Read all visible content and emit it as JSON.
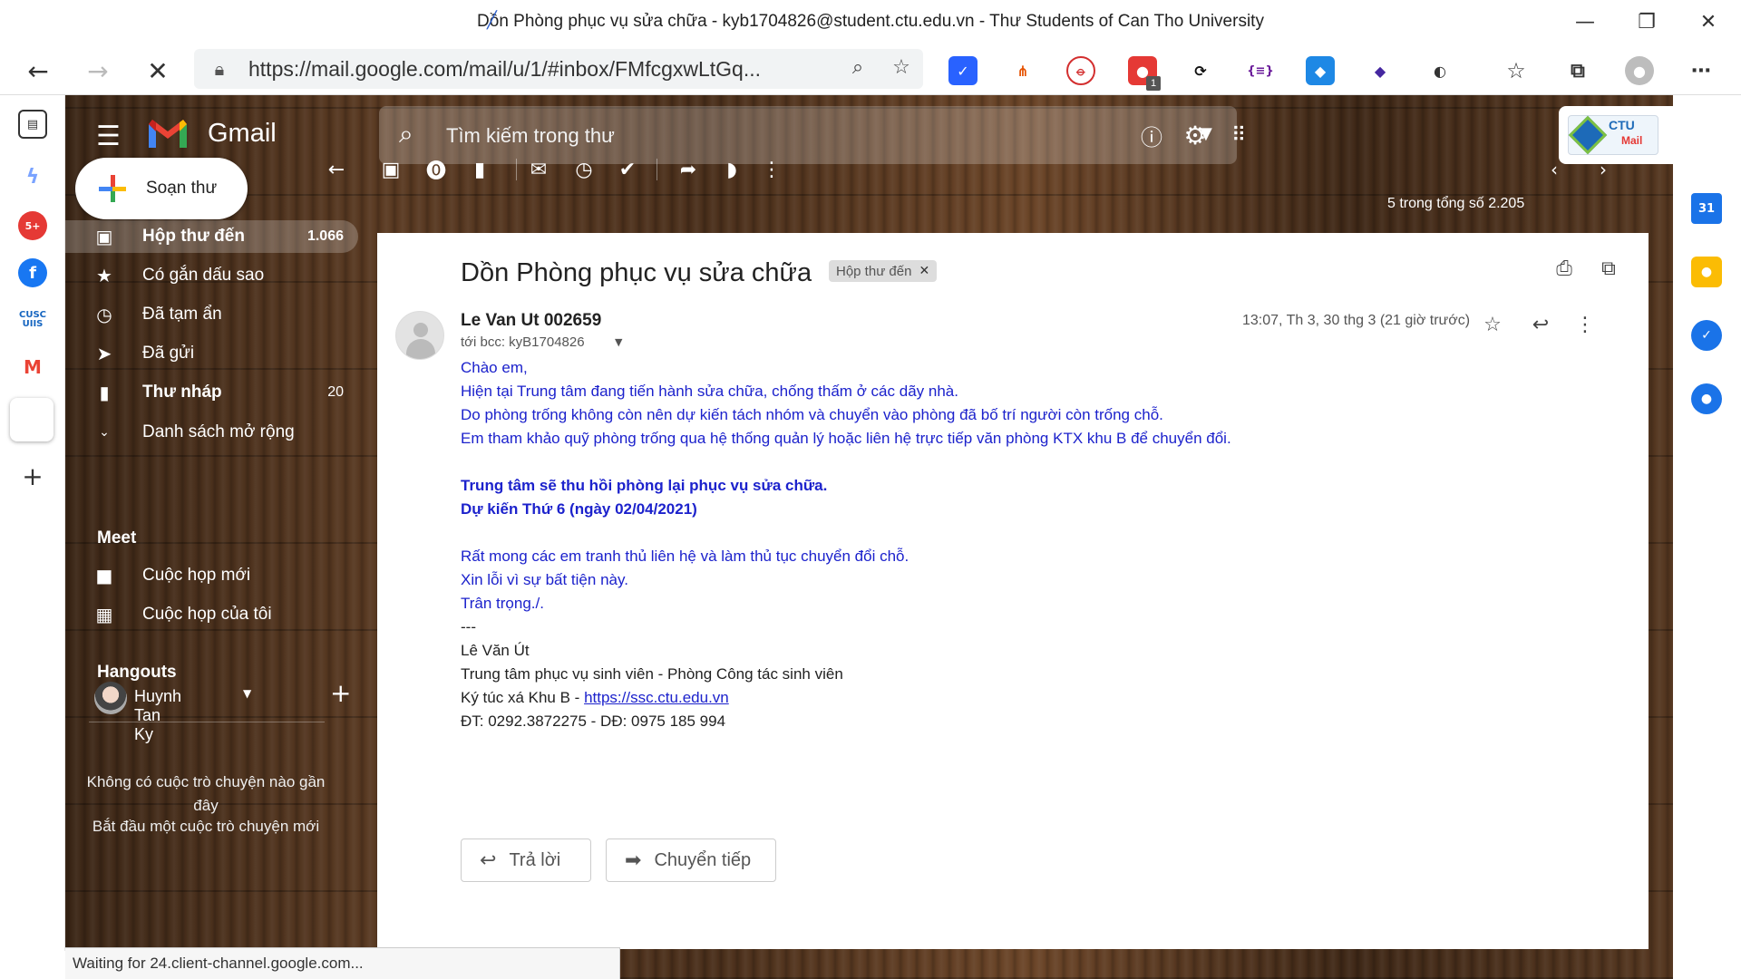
{
  "window": {
    "title": "Dồn Phòng phục vụ sửa chữa - kyb1704826@student.ctu.edu.vn - Thư Students of Can Tho University"
  },
  "browser": {
    "url": "https://mail.google.com/mail/u/1/#inbox/FMfcgxwLtGq...",
    "extension_badge": "1",
    "status_text": "Waiting for 24.client-channel.google.com..."
  },
  "gmail": {
    "brand": "Gmail",
    "search_placeholder": "Tìm kiếm trong thư",
    "account_logo": {
      "line1": "CTU",
      "line2": "Mail"
    },
    "compose_label": "Soạn thư",
    "nav": [
      {
        "label": "Hộp thư đến",
        "count": "1.066",
        "icon": "inbox-icon"
      },
      {
        "label": "Có gắn dấu sao",
        "count": "",
        "icon": "star-icon"
      },
      {
        "label": "Đã tạm ẩn",
        "count": "",
        "icon": "clock-icon"
      },
      {
        "label": "Đã gửi",
        "count": "",
        "icon": "send-icon"
      },
      {
        "label": "Thư nháp",
        "count": "20",
        "icon": "draft-icon"
      },
      {
        "label": "Danh sách mở rộng",
        "count": "",
        "icon": "chevron-down-icon"
      }
    ],
    "meet": {
      "title": "Meet",
      "items": [
        {
          "label": "Cuộc họp mới",
          "icon": "video-icon"
        },
        {
          "label": "Cuộc họp của tôi",
          "icon": "calendar-icon"
        }
      ]
    },
    "hangouts": {
      "title": "Hangouts",
      "user_name": "Huynh Tan Ky",
      "empty_text": "Không có cuộc trò chuyện nào gần đây",
      "start_text": "Bắt đầu một cuộc trò chuyện mới"
    },
    "paging": "5 trong tổng số 2.205"
  },
  "message": {
    "subject": "Dồn Phòng phục vụ sửa chữa",
    "label_chip": "Hộp thư đến",
    "sender": "Le Van Ut 002659",
    "recipient": "tới bcc: kyB1704826",
    "time": "13:07, Th 3, 30 thg 3 (21 giờ trước)",
    "body": {
      "greeting": "Chào em,",
      "p1": "Hiện tại Trung tâm đang tiến hành sửa chữa, chống thấm ở các dãy nhà.",
      "p2": "Do phòng trống không còn nên dự kiến tách nhóm và chuyển vào phòng đã bố trí người còn trống chỗ.",
      "p3": "Em tham khảo quỹ phòng trống qua hệ thống quản lý hoặc liên hệ trực tiếp văn phòng KTX khu B để chuyển đổi.",
      "bold1": "Trung tâm sẽ thu hồi phòng lại phục vụ sửa chữa.",
      "bold2": "Dự kiến Thứ 6 (ngày 02/04/2021)",
      "p4": "Rất mong các em tranh thủ liên hệ và làm thủ tục chuyển đổi chỗ.",
      "p5": "Xin lỗi vì sự bất tiện này.",
      "p6": "Trân trọng./.",
      "sig_sep": "---",
      "sig_name": "Lê Văn Út",
      "sig_org": "Trung tâm phục vụ sinh viên - Phòng Công tác sinh viên",
      "sig_dorm_prefix": "Ký túc xá Khu B - ",
      "sig_link": "https://ssc.ctu.edu.vn",
      "sig_phone": "ĐT: 0292.3872275 - DĐ: 0975 185 994"
    },
    "reply_label": "Trả lời",
    "forward_label": "Chuyển tiếp"
  },
  "colors": {
    "body_text": "#1c22cc",
    "gmail_red": "#ea4335"
  }
}
